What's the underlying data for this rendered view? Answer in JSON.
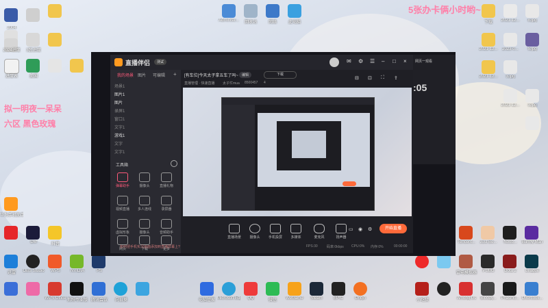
{
  "overlay": {
    "top_right": "5张办卡俩小时哟~",
    "left_line1": "拟一明夜一呆呆",
    "left_line2": "六区 黑色玫瑰"
  },
  "desktop_left_icons": [
    {
      "label": "Administr..."
    },
    {
      "label": "2004"
    },
    {
      "label": "2024进度"
    },
    {
      "label": "3区进度"
    },
    {
      "label": "进度表"
    },
    {
      "label": "美国"
    },
    {
      "label": "百度网盘"
    },
    {
      "label": "2023"
    },
    {
      "label": "ClickUp"
    }
  ],
  "desktop_right_icons": [
    {
      "label": "下载"
    },
    {
      "label": "2021-12..."
    },
    {
      "label": "8.jpg"
    },
    {
      "label": "2021-12..."
    },
    {
      "label": "2023-0..."
    },
    {
      "label": "5.jpg"
    },
    {
      "label": "2021-12..."
    },
    {
      "label": "3.jpg"
    },
    {
      "label": "2021-12..."
    },
    {
      "label": "3.jpg"
    }
  ],
  "desktop_top_icons": [
    {
      "label": "Administr..."
    },
    {
      "label": "回收站"
    },
    {
      "label": "网络"
    },
    {
      "label": "此电脑"
    }
  ],
  "taskbar_row1": [
    {
      "label": "华为手机助手"
    },
    {
      "label": "DM"
    },
    {
      "label": "抖音"
    },
    {
      "label": "OBS"
    },
    {
      "label": "WPS"
    },
    {
      "label": "NVIDIA"
    },
    {
      "label": "PS"
    }
  ],
  "taskbar_row2": [
    {
      "label": "迅雷"
    },
    {
      "label": "OBS Studio"
    },
    {
      "label": "WPS Office"
    },
    {
      "label": "剪映专业版"
    },
    {
      "label": "腾讯会议"
    },
    {
      "label": "向日葵"
    }
  ],
  "taskbar_center": [
    {
      "label": "电脑管家"
    },
    {
      "label": "Microsoft Edge"
    },
    {
      "label": "QQ"
    },
    {
      "label": "微信"
    },
    {
      "label": "WeGame"
    },
    {
      "label": "Steam"
    },
    {
      "label": "EPIC"
    },
    {
      "label": "Origin"
    }
  ],
  "taskbar_right_row1": [
    {
      "label": "Tencent..."
    },
    {
      "label": "Just Be..."
    },
    {
      "label": "Noob..."
    },
    {
      "label": "Bunny Man"
    },
    {
      "label": "雷电模拟器"
    },
    {
      "label": "PUBG"
    },
    {
      "label": "Dota 2"
    },
    {
      "label": "League"
    }
  ],
  "taskbar_right_row2": [
    {
      "label": "小吃货"
    },
    {
      "label": "Among Us"
    },
    {
      "label": "Among Us"
    },
    {
      "label": "Bloody..."
    },
    {
      "label": "Phasmo..."
    },
    {
      "label": "Overcook..."
    }
  ],
  "app": {
    "title": "直播伴侣",
    "version": "测试",
    "stream_title": "[有车位]今天太子拿五车了吗~",
    "edit_label": "编辑",
    "download_label": "下载",
    "status_line": "直播管理 · 快速直播",
    "viewers": "太子忙mua",
    "room_id": "8500457",
    "fans": "4",
    "tabs": [
      "我的场景",
      "图片",
      "可编辑"
    ],
    "scenes": [
      "场景1",
      "图片1",
      "图片",
      "录屏1",
      "窗口1",
      "文字1",
      "游戏1",
      "文字",
      "文字1"
    ],
    "tool_header": "工具箱",
    "tools": [
      "弹幕助手",
      "摄像头",
      "直播礼物",
      "视频直播",
      "多人连线",
      "录屏器",
      "虚拟形象",
      "摄像头",
      "音频助手",
      "网页",
      "下载",
      "更多"
    ],
    "bottom_buttons": [
      "直播场景",
      "摄像头",
      "手机投屏",
      "多媒体",
      "麦克风",
      "扬声器"
    ],
    "live_button": "开始直播",
    "tip": "如何把手机实况画面添加到直播屏幕上?",
    "fps": "FPS:30",
    "bitrate": "码率:0kbps",
    "cpu": "CPU:0%",
    "memory": "内存:0%",
    "timer": "00:00:00"
  },
  "right_panel": {
    "title": "网页一观看",
    "time": ":05"
  }
}
